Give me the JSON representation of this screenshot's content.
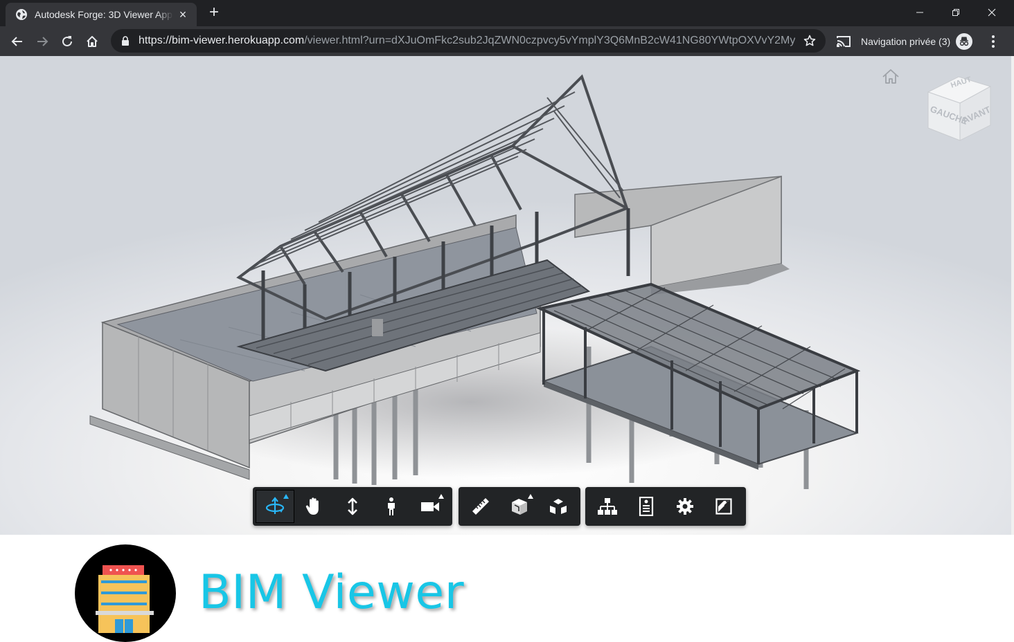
{
  "browser": {
    "tab": {
      "title": "Autodesk Forge: 3D Viewer App",
      "favicon": "globe-icon"
    },
    "new_tab_label": "+",
    "url_host": "https://bim-viewer.herokuapp.com",
    "url_rest": "/viewer.html?urn=dXJuOmFkc2sub2JqZWN0czpvcy5vYmplY3Q6MnB2cW41NG80YWtpOXVvY2My...",
    "incognito_label": "Navigation privée (3)",
    "theme": {
      "frame": "#202124",
      "toolbar": "#35363a",
      "text": "#e8eaed"
    }
  },
  "viewer": {
    "viewcube": {
      "top": "HAUT",
      "left": "GAUCHE",
      "front": "AVANT"
    },
    "toolbar_groups": [
      {
        "name": "navigation",
        "tools": [
          "orbit-icon",
          "pan-icon",
          "dolly-icon",
          "first-person-icon",
          "camera-icon"
        ],
        "active": "orbit-icon"
      },
      {
        "name": "modeling",
        "tools": [
          "measure-icon",
          "section-icon",
          "explode-icon"
        ]
      },
      {
        "name": "settings",
        "tools": [
          "model-browser-icon",
          "properties-icon",
          "settings-gear-icon",
          "fullscreen-icon"
        ]
      }
    ],
    "accent": "#29b6f6"
  },
  "brand": {
    "title": "BIM Viewer",
    "color": "#18c6e6"
  }
}
